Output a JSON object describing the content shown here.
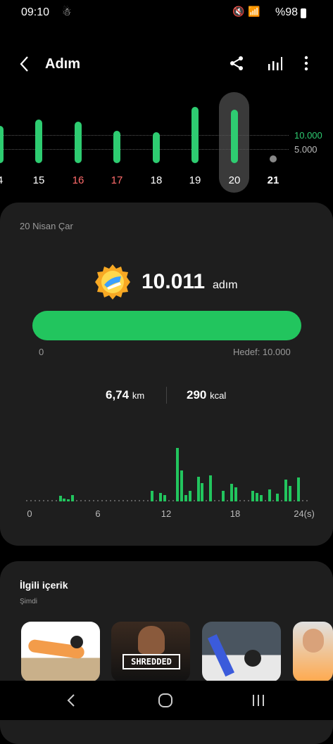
{
  "status_bar": {
    "time": "09:10",
    "battery": "%98"
  },
  "header": {
    "title": "Adım"
  },
  "week": {
    "days": [
      {
        "label": "4",
        "steps": 7000
      },
      {
        "label": "15",
        "steps": 8200
      },
      {
        "label": "16",
        "steps": 7800,
        "weekend": true
      },
      {
        "label": "17",
        "steps": 6000,
        "weekend": true
      },
      {
        "label": "18",
        "steps": 5800
      },
      {
        "label": "19",
        "steps": 10500
      },
      {
        "label": "20",
        "steps": 10011,
        "selected": true
      },
      {
        "label": "21",
        "steps": 0,
        "today": true
      }
    ],
    "goal_label_1": "10.000",
    "goal_label_2": "5.000"
  },
  "summary": {
    "date": "20 Nisan Çar",
    "steps": "10.011",
    "steps_unit": "adım",
    "progress_start": "0",
    "target": "Hedef: 10.000",
    "progress_fraction": 1.0,
    "distance_value": "6,74",
    "distance_unit": "km",
    "calories_value": "290",
    "calories_unit": "kcal",
    "hourly_axis": [
      "0",
      "6",
      "12",
      "18",
      "24(s)"
    ],
    "hourly_steps": [
      0,
      0,
      0,
      0,
      0,
      0,
      0,
      0,
      80,
      40,
      20,
      90,
      0,
      0,
      0,
      0,
      0,
      0,
      0,
      0,
      0,
      0,
      0,
      0,
      0,
      0,
      0,
      0,
      0,
      0,
      150,
      0,
      120,
      90,
      0,
      0,
      780,
      450,
      90,
      150,
      0,
      360,
      270,
      0,
      380,
      0,
      0,
      150,
      0,
      260,
      210,
      0,
      0,
      0,
      150,
      120,
      90,
      0,
      170,
      0,
      110,
      0,
      320,
      230,
      0,
      350,
      0,
      0
    ]
  },
  "related": {
    "title": "İlgili içerik",
    "subtitle": "Şimdi",
    "thumb_labels": [
      "",
      "SHREDDED",
      "",
      ""
    ]
  },
  "colors": {
    "accent": "#22c55e",
    "weekend": "#ff6b6b",
    "card": "#1e1e1e"
  }
}
